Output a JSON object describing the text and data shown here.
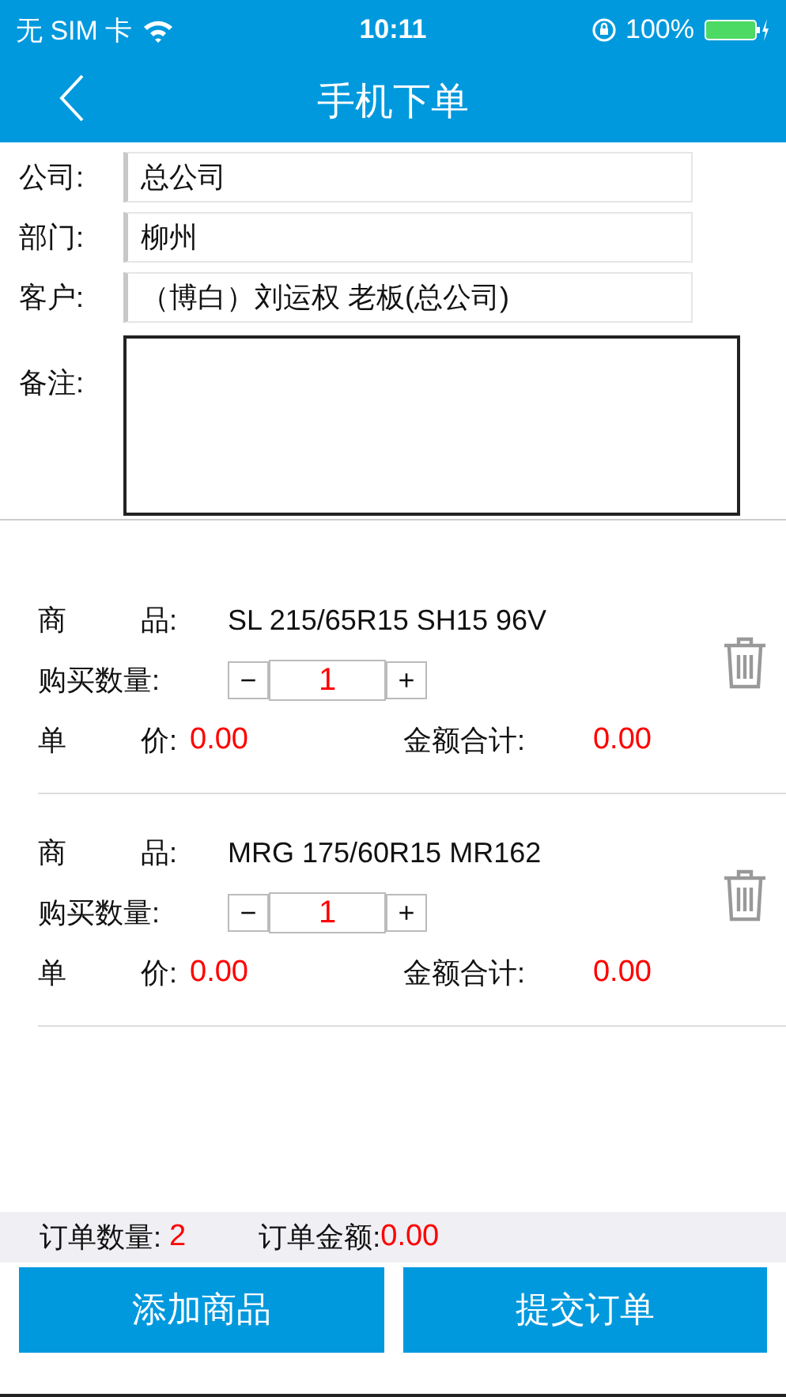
{
  "status_bar": {
    "carrier": "无 SIM 卡",
    "time": "10:11",
    "battery": "100%"
  },
  "nav": {
    "title": "手机下单"
  },
  "form": [
    {
      "kind": "field",
      "label": "公司:",
      "value": "总公司"
    },
    {
      "kind": "field",
      "label": "部门:",
      "value": "柳州"
    },
    {
      "kind": "field",
      "label": "客户:",
      "value": "（博白）刘运权 老板(总公司)"
    },
    {
      "kind": "area",
      "label": "备注:"
    }
  ],
  "items": [
    {
      "product_label": [
        "商",
        "品:"
      ],
      "product": "SL 215/65R15 SH15 96V",
      "qty_label": "购买数量:",
      "minus": "−",
      "qty": "1",
      "plus": "+",
      "price_label": [
        "单",
        "价:"
      ],
      "price": "0.00",
      "total_label": "金额合计:",
      "total": "0.00"
    },
    {
      "product_label": [
        "商",
        "品:"
      ],
      "product": "MRG 175/60R15 MR162",
      "qty_label": "购买数量:",
      "minus": "−",
      "qty": "1",
      "plus": "+",
      "price_label": [
        "单",
        "价:"
      ],
      "price": "0.00",
      "total_label": "金额合计:",
      "total": "0.00"
    }
  ],
  "summary": {
    "count_label": "订单数量:",
    "count": "2",
    "amount_label": "订单金额:",
    "amount": "0.00"
  },
  "buttons": [
    "添加商品",
    "提交订单"
  ]
}
